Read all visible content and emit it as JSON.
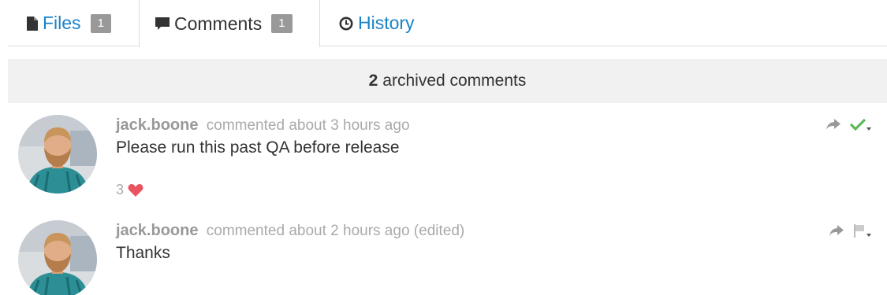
{
  "tabs": [
    {
      "label": "Files",
      "count": "1",
      "icon": "file-icon"
    },
    {
      "label": "Comments",
      "count": "1",
      "icon": "comment-icon",
      "active": true
    },
    {
      "label": "History",
      "icon": "clock-icon"
    }
  ],
  "banner": {
    "count": "2",
    "text": "archived comments"
  },
  "comments": [
    {
      "author": "jack.boone",
      "verb": "commented",
      "time": "about 3 hours ago",
      "edited": "",
      "body": "Please run this past QA before release",
      "likes": "3",
      "status_icon": "check-icon"
    },
    {
      "author": "jack.boone",
      "verb": "commented",
      "time": "about 2 hours ago",
      "edited": "(edited)",
      "body": "Thanks",
      "status_icon": "flag-icon"
    }
  ],
  "colors": {
    "link": "#1a82c8",
    "badge": "#999999",
    "banner_bg": "#f1f1f1",
    "heart": "#e8545f",
    "check": "#5cb85c",
    "muted": "#aaaaaa"
  }
}
